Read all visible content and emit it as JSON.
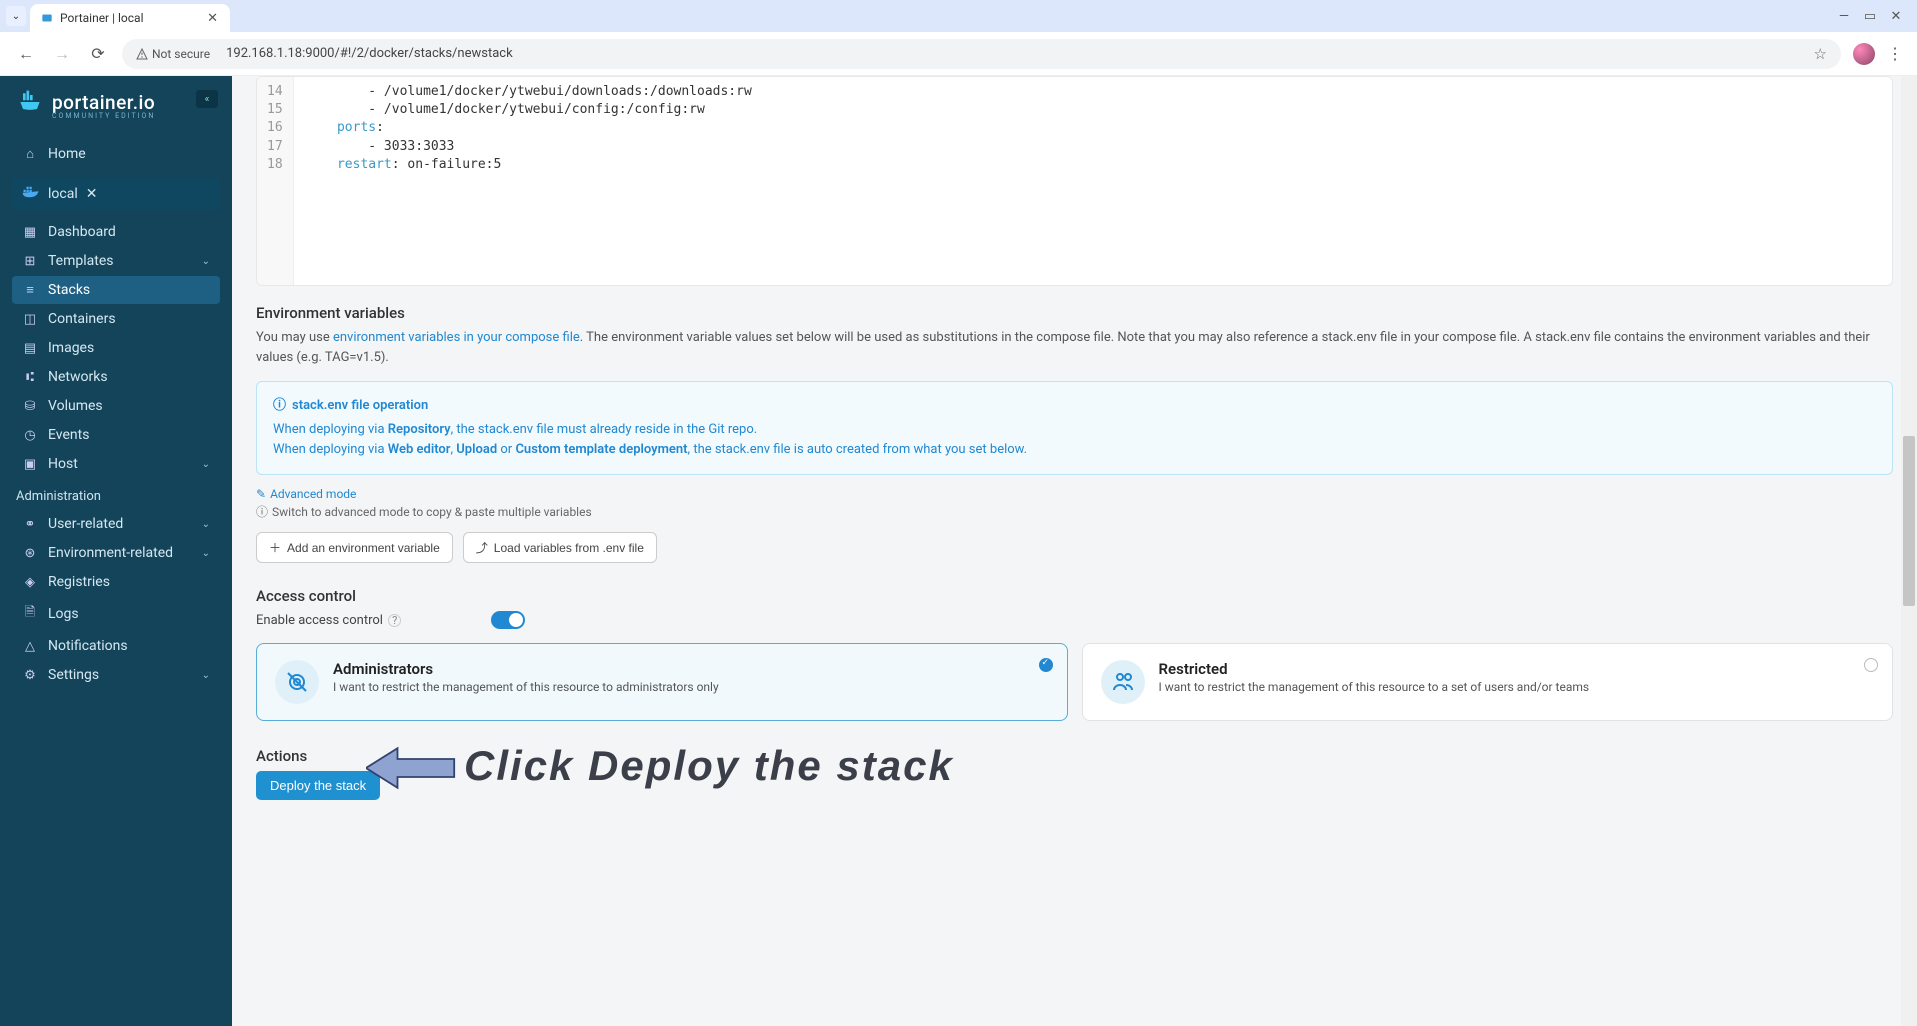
{
  "browser": {
    "tab_title": "Portainer | local",
    "security_label": "Not secure",
    "url": "192.168.1.18:9000/#!/2/docker/stacks/newstack"
  },
  "sidebar": {
    "brand": "portainer.io",
    "brand_sub": "COMMUNITY EDITION",
    "home": "Home",
    "env": "local",
    "items": [
      {
        "icon": "dashboard",
        "label": "Dashboard"
      },
      {
        "icon": "templates",
        "label": "Templates",
        "expandable": true
      },
      {
        "icon": "stacks",
        "label": "Stacks",
        "active": true
      },
      {
        "icon": "containers",
        "label": "Containers"
      },
      {
        "icon": "images",
        "label": "Images"
      },
      {
        "icon": "networks",
        "label": "Networks"
      },
      {
        "icon": "volumes",
        "label": "Volumes"
      },
      {
        "icon": "events",
        "label": "Events"
      },
      {
        "icon": "host",
        "label": "Host",
        "expandable": true
      }
    ],
    "admin_label": "Administration",
    "admin_items": [
      {
        "icon": "users",
        "label": "User-related",
        "expandable": true
      },
      {
        "icon": "env",
        "label": "Environment-related",
        "expandable": true
      },
      {
        "icon": "registries",
        "label": "Registries"
      },
      {
        "icon": "logs",
        "label": "Logs"
      },
      {
        "icon": "notifications",
        "label": "Notifications"
      },
      {
        "icon": "settings",
        "label": "Settings",
        "expandable": true
      }
    ]
  },
  "editor": {
    "lines": [
      {
        "n": 14,
        "indent": 4,
        "text": "- /volume1/docker/ytwebui/downloads:/downloads:rw"
      },
      {
        "n": 15,
        "indent": 4,
        "text": "- /volume1/docker/ytwebui/config:/config:rw"
      },
      {
        "n": 16,
        "indent": 2,
        "key": "ports",
        "suffix": ":"
      },
      {
        "n": 17,
        "indent": 4,
        "text": "- 3033:3033"
      },
      {
        "n": 18,
        "indent": 2,
        "key": "restart",
        "suffix": ": on-failure:5"
      }
    ]
  },
  "env_section": {
    "title": "Environment variables",
    "desc_pre": "You may use ",
    "desc_link": "environment variables in your compose file",
    "desc_post": ". The environment variable values set below will be used as substitutions in the compose file. Note that you may also reference a stack.env file in your compose file. A stack.env file contains the environment variables and their values (e.g. TAG=v1.5).",
    "info_title": "stack.env file operation",
    "info_line1_pre": "When deploying via ",
    "info_line1_b": "Repository",
    "info_line1_post": ", the stack.env file must already reside in the Git repo.",
    "info_line2_pre": "When deploying via ",
    "info_line2_b1": "Web editor",
    "info_line2_mid1": ", ",
    "info_line2_b2": "Upload",
    "info_line2_mid2": " or ",
    "info_line2_b3": "Custom template deployment",
    "info_line2_post": ", the stack.env file is auto created from what you set below.",
    "advanced_mode": "Advanced mode",
    "advanced_hint": "Switch to advanced mode to copy & paste multiple variables",
    "add_btn": "Add an environment variable",
    "load_btn": "Load variables from .env file"
  },
  "access": {
    "title": "Access control",
    "toggle_label": "Enable access control",
    "cards": [
      {
        "title": "Administrators",
        "desc": "I want to restrict the management of this resource to administrators only",
        "selected": true
      },
      {
        "title": "Restricted",
        "desc": "I want to restrict the management of this resource to a set of users and/or teams",
        "selected": false
      }
    ]
  },
  "actions": {
    "title": "Actions",
    "deploy_btn": "Deploy the stack"
  },
  "annotation": {
    "text": "Click Deploy the stack"
  }
}
